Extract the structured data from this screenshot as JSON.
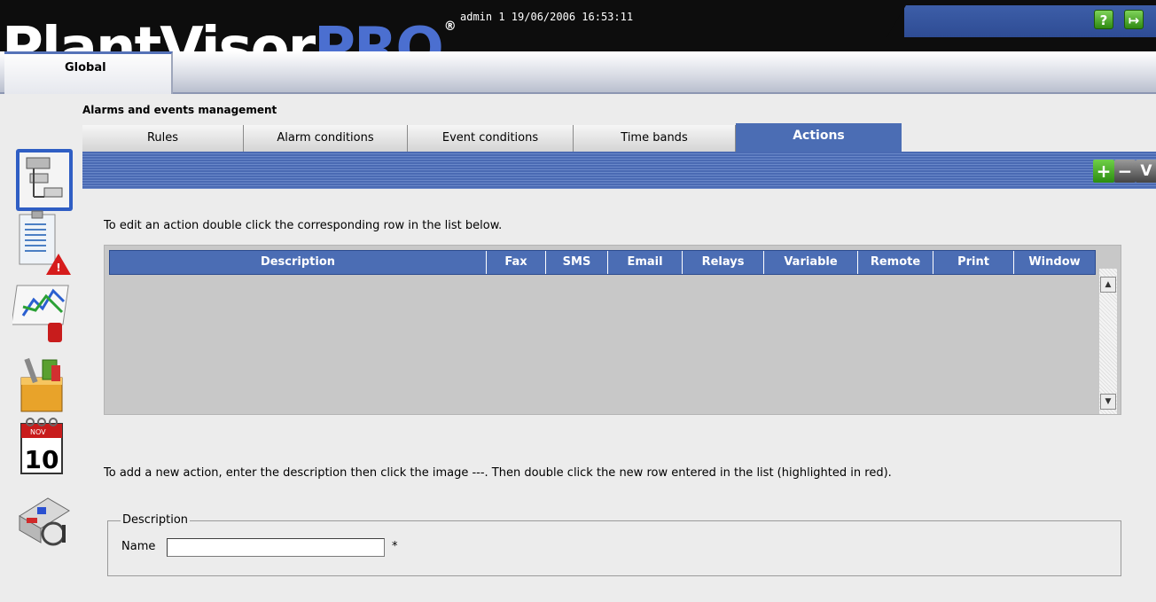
{
  "header": {
    "logo_main": "PlantVisor",
    "logo_accent": "PRO",
    "logo_reg": "®",
    "user_info": "admin 1 19/06/2006 16:53:11",
    "help_glyph": "?",
    "exit_glyph": "↦"
  },
  "global": {
    "label": "Global"
  },
  "sidebar": {
    "icons": [
      "layout-icon",
      "alarm-report-icon",
      "graph-icon",
      "tools-box-icon",
      "calendar-icon",
      "plant-map-icon"
    ],
    "calendar_month": "NOV",
    "calendar_day": "10"
  },
  "section": {
    "title": "Alarms and events management"
  },
  "tabs": [
    {
      "label": "Rules"
    },
    {
      "label": "Alarm conditions"
    },
    {
      "label": "Event conditions"
    },
    {
      "label": "Time bands"
    },
    {
      "label": "Actions"
    }
  ],
  "toolbar": {
    "add_glyph": "+",
    "remove_glyph": "−",
    "confirm_glyph": "V"
  },
  "content": {
    "instr_edit": "To edit an action double click the corresponding row in the list below.",
    "instr_add": "To add a new action, enter the description then click the image ---. Then double click the new row entered in the list (highlighted in red)."
  },
  "table": {
    "columns": [
      "Description",
      "Fax",
      "SMS",
      "Email",
      "Relays",
      "Variable",
      "Remote",
      "Print",
      "Window"
    ],
    "rows": []
  },
  "scrollbar": {
    "up_glyph": "▲",
    "down_glyph": "▼"
  },
  "form": {
    "legend": "Description",
    "name_label": "Name",
    "name_value": "",
    "required_mark": "*"
  },
  "colors": {
    "accent": "#4b6db4",
    "header_bg": "#0d0d0d",
    "page_bg": "#ececec"
  }
}
